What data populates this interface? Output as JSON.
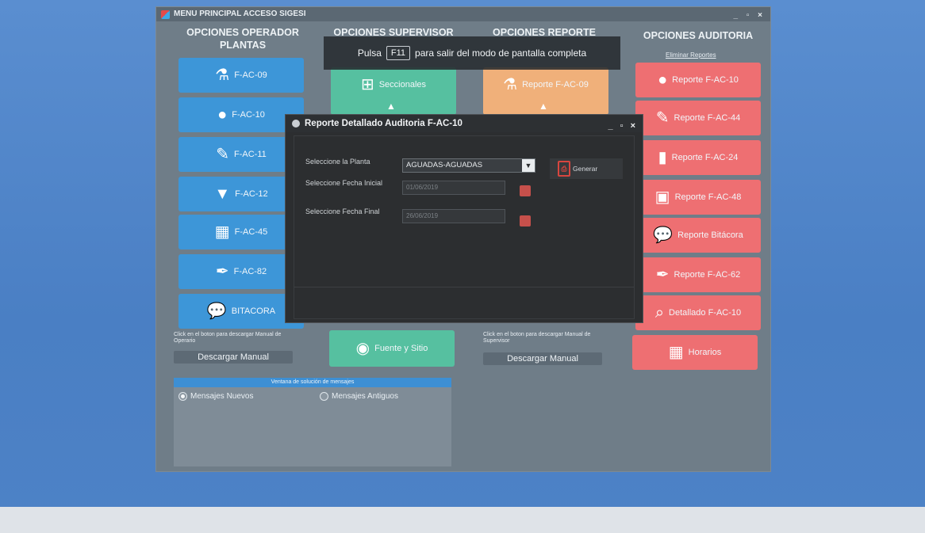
{
  "window": {
    "title": "MENU PRINCIPAL ACCESO SIGESI",
    "controls": "_ ▫ ×"
  },
  "columns": {
    "operador": {
      "header": "OPCIONES OPERADOR PLANTAS",
      "tiles": [
        "F-AC-09",
        "F-AC-10",
        "F-AC-11",
        "F-AC-12",
        "F-AC-45",
        "F-AC-82",
        "BITACORA"
      ],
      "note": "Click en el boton para descargar Manual de Operario",
      "download": "Descargar Manual"
    },
    "supervisor": {
      "header": "OPCIONES SUPERVISOR",
      "tiles": [
        "Seccionales",
        "",
        "Fuente y Sitio"
      ]
    },
    "reporte": {
      "header": "OPCIONES REPORTE",
      "tiles": [
        "Reporte F-AC-09",
        ""
      ],
      "note": "Click en el boton para descargar Manual de Supervisor",
      "download": "Descargar Manual"
    },
    "auditoria": {
      "header": "OPCIONES AUDITORIA",
      "link": "Eliminar Reportes",
      "tiles": [
        "Reporte F-AC-10",
        "Reporte F-AC-44",
        "Reporte F-AC-24",
        "Reporte F-AC-48",
        "Reporte Bitácora",
        "Reporte F-AC-62",
        "Detallado F-AC-10",
        "Horarios"
      ]
    }
  },
  "messages": {
    "header": "Ventana de solución de mensajes",
    "option_new": "Mensajes Nuevos",
    "option_old": "Mensajes Antiguos",
    "selected": "Mensajes Nuevos"
  },
  "fullscreen_hint": {
    "prefix": "Pulsa",
    "key": "F11",
    "suffix": "para salir del modo de pantalla completa"
  },
  "dialog": {
    "title": "Reporte Detallado Auditoria F-AC-10",
    "controls": "_ ▫ ×",
    "plant_label": "Seleccione la Planta",
    "plant_value": "AGUADAS-AGUADAS",
    "start_label": "Seleccione Fecha Inicial",
    "start_value": "01/06/2019",
    "end_label": "Seleccione Fecha Final",
    "end_value": "26/06/2019",
    "generate_label": "Generar"
  },
  "colors": {
    "blue_tile": "#3d96d8",
    "green_tile": "#56c0a0",
    "orange_tile": "#f0b07a",
    "red_tile": "#ee6f72"
  }
}
